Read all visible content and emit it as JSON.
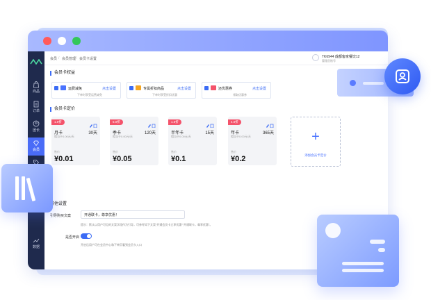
{
  "window": {
    "controls": [
      "close",
      "minimize",
      "maximize"
    ]
  },
  "sidebar": {
    "items": [
      {
        "label": "商品",
        "icon": "bag-icon",
        "active": false
      },
      {
        "label": "订单",
        "icon": "document-icon",
        "active": false
      },
      {
        "label": "团长",
        "icon": "person-icon",
        "active": false
      },
      {
        "label": "会员",
        "icon": "diamond-icon",
        "active": true
      },
      {
        "label": "营销",
        "icon": "tag-icon",
        "active": false
      },
      {
        "label": "数据",
        "icon": "chart-icon",
        "active": false
      }
    ]
  },
  "breadcrumb": [
    "会员",
    "会员管理",
    "会员卡设置"
  ],
  "user": {
    "name": "TK6944 成都客家餐饮12",
    "sub": "管理员账号"
  },
  "benefits_section": {
    "title": "会员卡权益"
  },
  "benefits": [
    {
      "name": "运费减免",
      "action": "点击设置",
      "desc": "下单时享受运费减免",
      "icon_color": "#4a73ff"
    },
    {
      "name": "专属折扣商品",
      "action": "点击设置",
      "desc": "下单时享受折扣优惠",
      "icon_color": "#f5a623"
    },
    {
      "name": "还优惠券",
      "action": "点击设置",
      "desc": "领取优惠券",
      "icon_color": "#f4536b"
    }
  ],
  "pricing_section": {
    "title": "会员卡定价"
  },
  "cards": [
    {
      "badge": "1.0折",
      "name": "月卡",
      "days": "30天",
      "note": "相当于0.00元/天",
      "sale_label": "售价",
      "price": "¥0.01"
    },
    {
      "badge": "5.0折",
      "name": "季卡",
      "days": "120天",
      "note": "相当于0.00元/天",
      "sale_label": "售价",
      "price": "¥0.05"
    },
    {
      "badge": "1.0折",
      "name": "半年卡",
      "days": "15天",
      "note": "相当于0.00元/天",
      "sale_label": "售价",
      "price": "¥0.1"
    },
    {
      "badge": "4.0折",
      "name": "年卡",
      "days": "365天",
      "note": "相当于0.00元/天",
      "sale_label": "售价",
      "price": "¥0.2"
    }
  ],
  "add_card": {
    "label": "添加会员卡定价"
  },
  "other_section": {
    "title": "其他设置"
  },
  "guide": {
    "label": "引导购买文案",
    "value": "开通联卡，尊享优惠！",
    "hint": "提示：默认以用户可见的文案字段作为引导，可参考如下文案“开通会员卡立享优惠”“开通联卡，尊享优惠”。"
  },
  "enable": {
    "label": "是否开启",
    "hint": "开启后用户可在会员中心和下单页看到会员卡入口"
  },
  "colors": {
    "accent": "#3c6cf5",
    "sidebar": "#1f2a4d",
    "badge": "#f4536b"
  }
}
